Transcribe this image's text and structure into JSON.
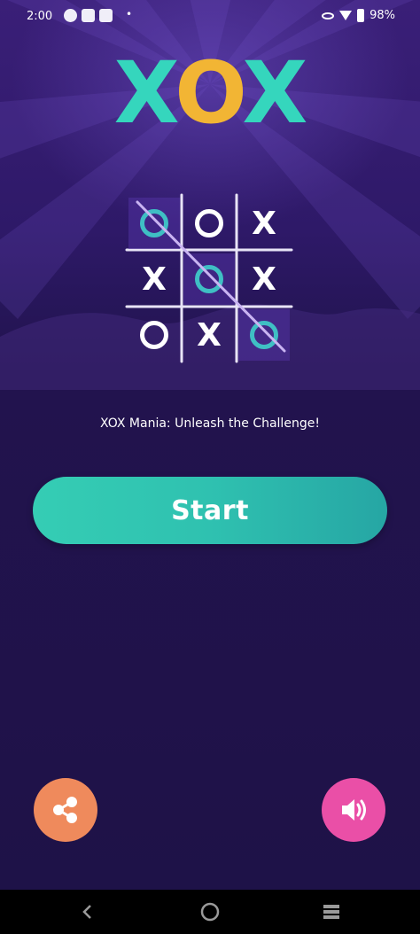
{
  "status_bar": {
    "time": "2:00",
    "notification_icons": [
      "alert-icon",
      "image-icon",
      "message-icon"
    ],
    "battery": "98%"
  },
  "logo": {
    "letter_1": "X",
    "letter_2": "O",
    "letter_3": "X"
  },
  "board": {
    "cells": [
      "O",
      "O",
      "X",
      "X",
      "O",
      "X",
      "O",
      "X",
      "O"
    ],
    "winning_cells": [
      0,
      4,
      8
    ]
  },
  "tagline": "XOX Mania: Unleash the Challenge!",
  "start_label": "Start",
  "icons": {
    "share": "share-icon",
    "sound": "speaker-icon",
    "nav": [
      "back-icon",
      "home-icon",
      "recents-icon"
    ]
  },
  "colors": {
    "background": "#22134e",
    "logo_x": "#35d6bd",
    "logo_o": "#f2b534",
    "start_button": "#2fc1b0",
    "share_button": "#ef8a5c",
    "sound_button": "#ea4fa7",
    "winning_mark": "#3fbfc4",
    "strike_line": "#c9b4f2"
  }
}
